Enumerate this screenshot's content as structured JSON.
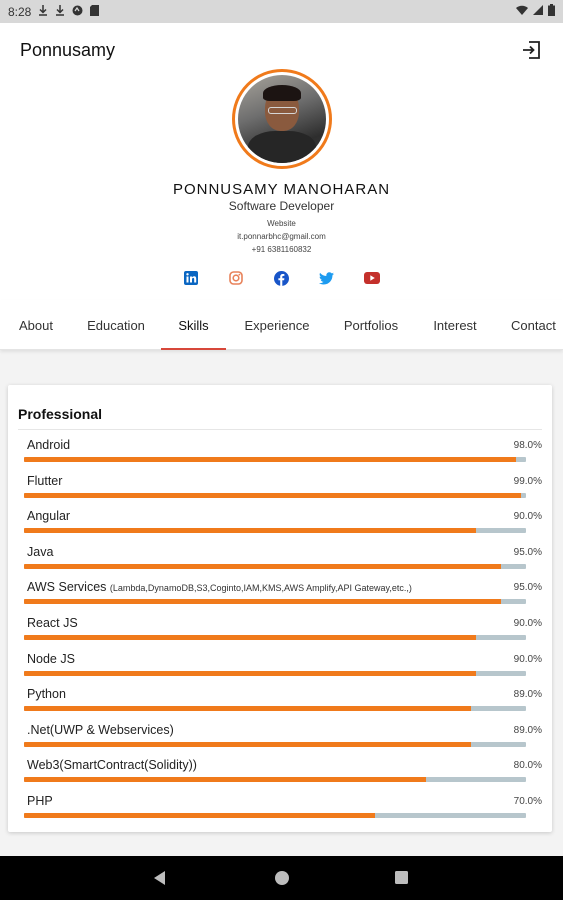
{
  "status_bar": {
    "time": "8:28",
    "left_icons": [
      "download-icon",
      "download-icon",
      "sync-icon",
      "sd-card-icon"
    ],
    "right_icons": [
      "wifi-icon",
      "signal-icon",
      "battery-icon"
    ]
  },
  "app_bar": {
    "title": "Ponnusamy",
    "action_icon": "logout-icon"
  },
  "profile": {
    "name": "PONNUSAMY MANOHARAN",
    "role": "Software Developer",
    "website": "Website",
    "email": "it.ponnarbhc@gmail.com",
    "phone": "+91  6381160832",
    "avatar_border_color": "#f07a1b",
    "social": [
      {
        "name": "linkedin-icon",
        "color": "#0a66c2"
      },
      {
        "name": "instagram-icon",
        "color": "#e8825a"
      },
      {
        "name": "facebook-icon",
        "color": "#1855c8"
      },
      {
        "name": "twitter-icon",
        "color": "#1d9bf0"
      },
      {
        "name": "youtube-icon",
        "color": "#c4302b"
      }
    ]
  },
  "tabs": [
    {
      "label": "About",
      "active": false
    },
    {
      "label": "Education",
      "active": false
    },
    {
      "label": "Skills",
      "active": true
    },
    {
      "label": "Experience",
      "active": false
    },
    {
      "label": "Portfolios",
      "active": false
    },
    {
      "label": "Interest",
      "active": false
    },
    {
      "label": "Contact",
      "active": false
    }
  ],
  "skills": {
    "section_title": "Professional",
    "bar_color": "#f07a1b",
    "track_color": "#b7c6cc",
    "items": [
      {
        "label": "Android",
        "detail": "",
        "percent": "98.0%",
        "value": 98.0
      },
      {
        "label": "Flutter",
        "detail": "",
        "percent": "99.0%",
        "value": 99.0
      },
      {
        "label": "Angular",
        "detail": "",
        "percent": "90.0%",
        "value": 90.0
      },
      {
        "label": "Java",
        "detail": "",
        "percent": "95.0%",
        "value": 95.0
      },
      {
        "label": "AWS Services",
        "detail": "(Lambda,DynamoDB,S3,Coginto,IAM,KMS,AWS Amplify,API Gateway,etc.,)",
        "percent": "95.0%",
        "value": 95.0
      },
      {
        "label": "React JS",
        "detail": "",
        "percent": "90.0%",
        "value": 90.0
      },
      {
        "label": "Node JS",
        "detail": "",
        "percent": "90.0%",
        "value": 90.0
      },
      {
        "label": "Python",
        "detail": "",
        "percent": "89.0%",
        "value": 89.0
      },
      {
        "label": ".Net(UWP & Webservices)",
        "detail": "",
        "percent": "89.0%",
        "value": 89.0
      },
      {
        "label": "Web3(SmartContract(Solidity))",
        "detail": "",
        "percent": "80.0%",
        "value": 80.0
      },
      {
        "label": "PHP",
        "detail": "",
        "percent": "70.0%",
        "value": 70.0
      }
    ]
  },
  "nav_bar": {
    "buttons": [
      "back-icon",
      "home-icon",
      "recents-icon"
    ]
  }
}
